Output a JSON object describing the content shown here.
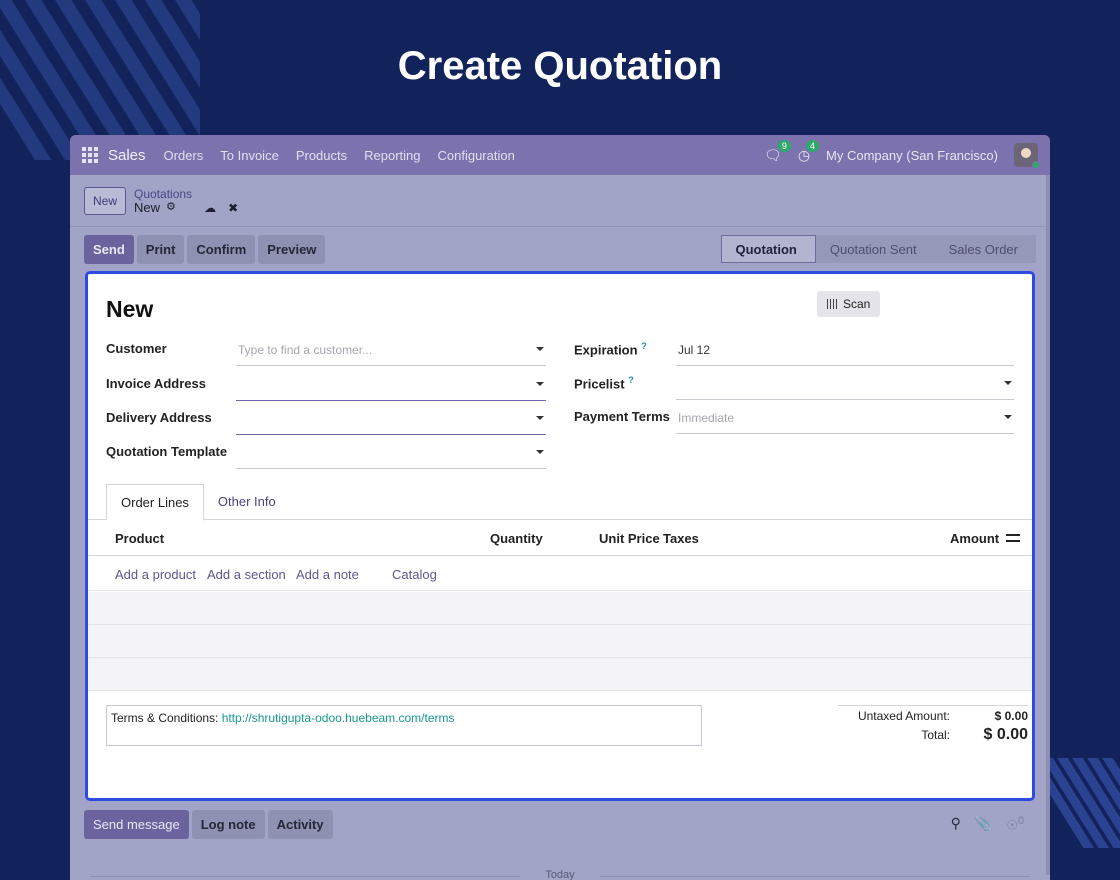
{
  "hero": {
    "title": "Create Quotation"
  },
  "topbar": {
    "brand": "Sales",
    "menu": [
      "Orders",
      "To Invoice",
      "Products",
      "Reporting",
      "Configuration"
    ],
    "messages_badge": "9",
    "activities_badge": "4",
    "company": "My Company (San Francisco)"
  },
  "control": {
    "new_label": "New",
    "breadcrumb_parent": "Quotations",
    "breadcrumb_current": "New"
  },
  "actions": {
    "send": "Send",
    "print": "Print",
    "confirm": "Confirm",
    "preview": "Preview"
  },
  "statusbar": {
    "stages": [
      "Quotation",
      "Quotation Sent",
      "Sales Order"
    ],
    "active": "Quotation"
  },
  "form": {
    "title": "New",
    "scan_label": "Scan",
    "customer_label": "Customer",
    "customer_placeholder": "Type to find a customer...",
    "invoice_address_label": "Invoice Address",
    "delivery_address_label": "Delivery Address",
    "quotation_template_label": "Quotation Template",
    "expiration_label": "Expiration",
    "expiration_value": "Jul 12",
    "pricelist_label": "Pricelist",
    "payment_terms_label": "Payment Terms",
    "payment_terms_placeholder": "Immediate",
    "help_mark": "?"
  },
  "tabs": [
    "Order Lines",
    "Other Info"
  ],
  "order_lines": {
    "columns": {
      "product": "Product",
      "quantity": "Quantity",
      "unit_price": "Unit Price",
      "taxes": "Taxes",
      "amount": "Amount"
    },
    "add_product": "Add a product",
    "add_section": "Add a section",
    "add_note": "Add a note",
    "catalog": "Catalog"
  },
  "terms": {
    "label": "Terms & Conditions:",
    "url": "http://shrutigupta-odoo.huebeam.com/terms"
  },
  "totals": {
    "untaxed_label": "Untaxed Amount:",
    "untaxed_value": "$ 0.00",
    "total_label": "Total:",
    "total_value": "$ 0.00"
  },
  "chatter": {
    "send_message": "Send message",
    "log_note": "Log note",
    "activity": "Activity",
    "followers_count": "0",
    "today": "Today"
  },
  "colors": {
    "page_bg": "#12225a",
    "topbar": "#7b72ae",
    "primary": "#6a639e",
    "sheet_border": "#2d4be0",
    "link": "#17978d"
  }
}
